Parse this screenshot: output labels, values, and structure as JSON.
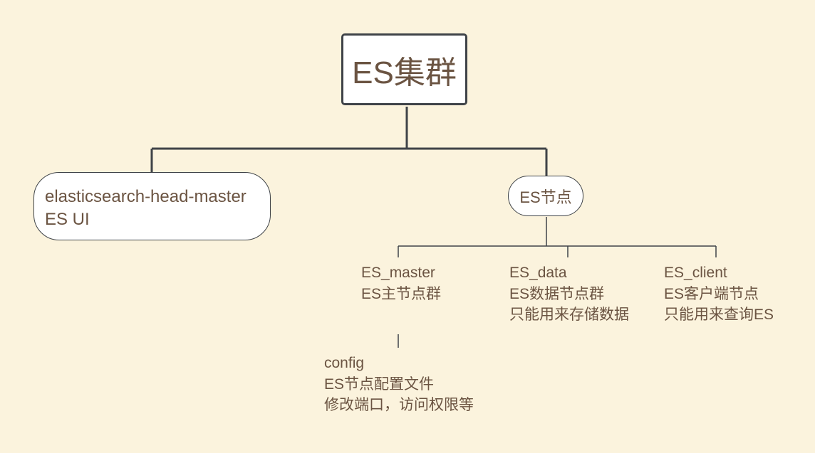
{
  "diagram": {
    "root": {
      "label": "ES集群"
    },
    "head_node": {
      "lines": [
        "elasticsearch-head-master",
        "ES UI"
      ]
    },
    "es_node": {
      "label": "ES节点"
    },
    "master": {
      "lines": [
        "ES_master",
        "ES主节点群"
      ]
    },
    "data": {
      "lines": [
        "ES_data",
        "ES数据节点群",
        "只能用来存储数据"
      ]
    },
    "client": {
      "lines": [
        "ES_client",
        "ES客户端节点",
        "只能用来查询ES"
      ]
    },
    "config": {
      "lines": [
        "config",
        "ES节点配置文件",
        "修改端口，访问权限等"
      ]
    }
  },
  "colors": {
    "background": "#fbf3dd",
    "text": "#6b5442",
    "line": "#3f4348",
    "node_fill": "#ffffff"
  }
}
